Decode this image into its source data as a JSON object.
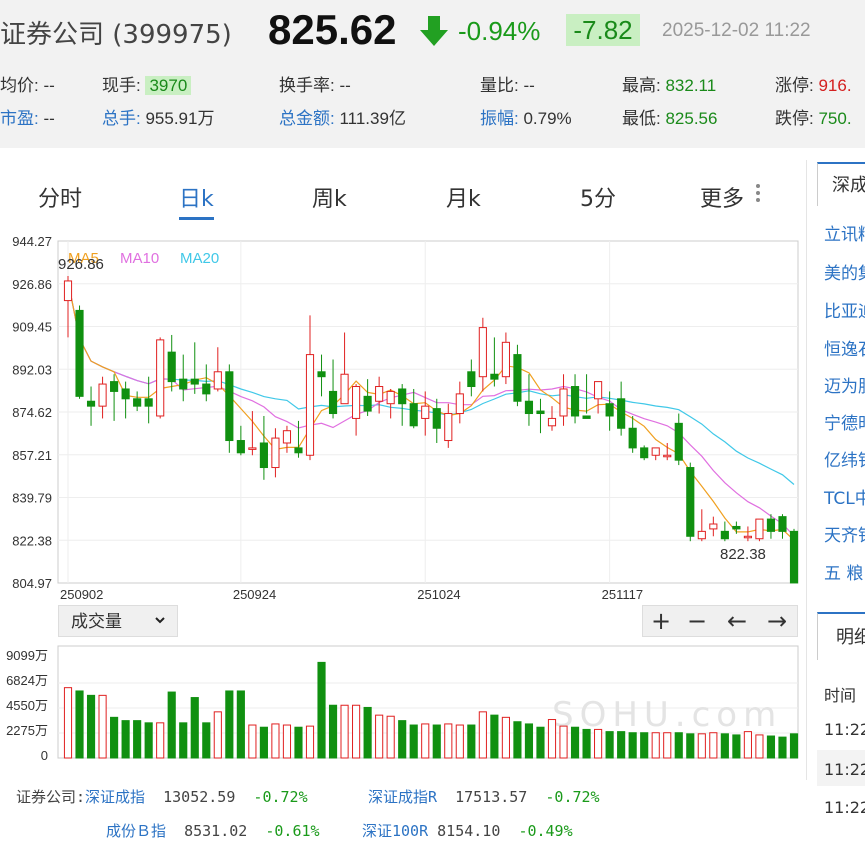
{
  "header": {
    "title": "证券公司 (399975)",
    "price": "825.62",
    "change_pct": "-0.94%",
    "change": "-7.82",
    "datetime": "2025-12-02 11:22",
    "arrow_color": "#22a022"
  },
  "stats": {
    "avg_label": "均价:",
    "avg_value": "--",
    "hand_label": "现手:",
    "hand_value": "3970",
    "turnover_label": "换手率:",
    "turnover_value": "--",
    "ratio_label": "量比:",
    "ratio_value": "--",
    "high_label": "最高:",
    "high_value": "832.11",
    "limitup_label": "涨停:",
    "limitup_value": "916.",
    "pe_label": "市盈:",
    "pe_value": "--",
    "total_hand_label": "总手:",
    "total_hand_value": "955.91万",
    "amount_label": "总金额:",
    "amount_value": "111.39亿",
    "amp_label": "振幅:",
    "amp_value": "0.79%",
    "low_label": "最低:",
    "low_value": "825.56",
    "limitdown_label": "跌停:",
    "limitdown_value": "750."
  },
  "tabs": [
    "分时",
    "日k",
    "周k",
    "月k",
    "5分",
    "更多"
  ],
  "active_tab": 1,
  "legend": {
    "ma5": "MA5",
    "ma10": "MA10",
    "ma20": "MA20"
  },
  "colors": {
    "up": "#e02020",
    "down": "#109010",
    "ma5": "#f0a020",
    "ma10": "#e070e0",
    "ma20": "#40c8e8",
    "accent": "#2c73c4"
  },
  "chart_data": {
    "type": "candlestick",
    "y_ticks": [
      "944.27",
      "926.86",
      "909.45",
      "892.03",
      "874.62",
      "857.21",
      "839.79",
      "822.38",
      "804.97"
    ],
    "ylim": [
      804.97,
      944.27
    ],
    "x_ticks": [
      {
        "label": "250902",
        "index": 0
      },
      {
        "label": "250924",
        "index": 15
      },
      {
        "label": "251024",
        "index": 31
      },
      {
        "label": "251117",
        "index": 47
      }
    ],
    "max_label": "926.86",
    "min_label": "822.38",
    "candles": [
      [
        920,
        930,
        928,
        905
      ],
      [
        916,
        918,
        881,
        880
      ],
      [
        879,
        885,
        877,
        869
      ],
      [
        877,
        889,
        886,
        872
      ],
      [
        887,
        890,
        883,
        871
      ],
      [
        884,
        887,
        880,
        872
      ],
      [
        880,
        883,
        877,
        875
      ],
      [
        880,
        889,
        877,
        870
      ],
      [
        873,
        905,
        904,
        872
      ],
      [
        899,
        906,
        887,
        883
      ],
      [
        888,
        898,
        884,
        879
      ],
      [
        888,
        903,
        886,
        882
      ],
      [
        886,
        894,
        882,
        879
      ],
      [
        884,
        901,
        891,
        883
      ],
      [
        891,
        894,
        863,
        858
      ],
      [
        863,
        869,
        858,
        857
      ],
      [
        860,
        875,
        860,
        857
      ],
      [
        862,
        873,
        852,
        847
      ],
      [
        852,
        868,
        864,
        848
      ],
      [
        862,
        869,
        867,
        858
      ],
      [
        860,
        871,
        858,
        856
      ],
      [
        857,
        914,
        898,
        855
      ],
      [
        891,
        898,
        889,
        881
      ],
      [
        883,
        896,
        874,
        872
      ],
      [
        878,
        907,
        890,
        881
      ],
      [
        872,
        886,
        885,
        865
      ],
      [
        881,
        888,
        875,
        873
      ],
      [
        879,
        889,
        885,
        874
      ],
      [
        878,
        884,
        883,
        872
      ],
      [
        884,
        886,
        878,
        869
      ],
      [
        878,
        884,
        869,
        868
      ],
      [
        872,
        883,
        877,
        865
      ],
      [
        876,
        880,
        868,
        862
      ],
      [
        863,
        878,
        874,
        860
      ],
      [
        874,
        887,
        882,
        870
      ],
      [
        891,
        896,
        885,
        881
      ],
      [
        889,
        913,
        909,
        883
      ],
      [
        890,
        905,
        888,
        885
      ],
      [
        889,
        907,
        903,
        886
      ],
      [
        898,
        902,
        879,
        877
      ],
      [
        879,
        890,
        874,
        869
      ],
      [
        875,
        880,
        874,
        866
      ],
      [
        869,
        877,
        872,
        867
      ],
      [
        873,
        890,
        884,
        869
      ],
      [
        885,
        890,
        873,
        870
      ],
      [
        873,
        890,
        872,
        874
      ],
      [
        880,
        887,
        887,
        874
      ],
      [
        878,
        883,
        873,
        867
      ],
      [
        880,
        887,
        868,
        865
      ],
      [
        868,
        873,
        860,
        858
      ],
      [
        860,
        861,
        856,
        855
      ],
      [
        857,
        859,
        860,
        855
      ],
      [
        857,
        862,
        857,
        855
      ],
      [
        870,
        874,
        855,
        853
      ],
      [
        852,
        854,
        824,
        822
      ],
      [
        823,
        835,
        826,
        822
      ],
      [
        827,
        832,
        829,
        824
      ],
      [
        826,
        830,
        823,
        822
      ],
      [
        828,
        830,
        827,
        825
      ],
      [
        824,
        828,
        824,
        822
      ],
      [
        823,
        831,
        831,
        822
      ],
      [
        831,
        833,
        826,
        823
      ],
      [
        832,
        833,
        826,
        823
      ],
      [
        826,
        827,
        805,
        805
      ]
    ]
  },
  "volume": {
    "selector_label": "成交量",
    "y_ticks": [
      "9099万",
      "6824万",
      "4550万",
      "2275万",
      "0"
    ],
    "values": [
      6400,
      6100,
      5700,
      5700,
      3700,
      3400,
      3400,
      3200,
      3200,
      6000,
      3200,
      5500,
      3200,
      4200,
      6100,
      6100,
      3000,
      2800,
      3100,
      3000,
      2800,
      2900,
      8700,
      4800,
      4800,
      4800,
      4600,
      3900,
      3800,
      3400,
      3000,
      3100,
      3000,
      3100,
      3000,
      3000,
      4200,
      3900,
      3700,
      3300,
      3100,
      2800,
      3500,
      2900,
      2800,
      2600,
      2600,
      2400,
      2400,
      2300,
      2300,
      2300,
      2300,
      2300,
      2200,
      2200,
      2300,
      2200,
      2100,
      2400,
      2100,
      2000,
      1900,
      2200
    ]
  },
  "controls": {
    "zoom_in": "+",
    "zoom_out": "−",
    "left": "←",
    "right": "→"
  },
  "indices": [
    {
      "prefix": "证券公司:",
      "name": "深证成指",
      "price": "13052.59",
      "chg": "-0.72%"
    },
    {
      "name": "深证成指R",
      "price": "17513.57",
      "chg": "-0.72%"
    },
    {
      "name": "成份Ｂ指",
      "price": "8531.02",
      "chg": "-0.61%"
    },
    {
      "name": "深证100R",
      "price": "8154.10",
      "chg": "-0.49%"
    }
  ],
  "side": {
    "header": "深成",
    "items": [
      "立讯精",
      "美的集",
      "比亚迪",
      "恒逸石",
      "迈为股",
      "宁德时",
      "亿纬锂",
      "TCL中",
      "天齐锂",
      "五 粮"
    ],
    "header2": "明细",
    "time_label": "时间",
    "times": [
      "11:22",
      "11:22",
      "11:22"
    ]
  },
  "watermark": "SOHU.com"
}
